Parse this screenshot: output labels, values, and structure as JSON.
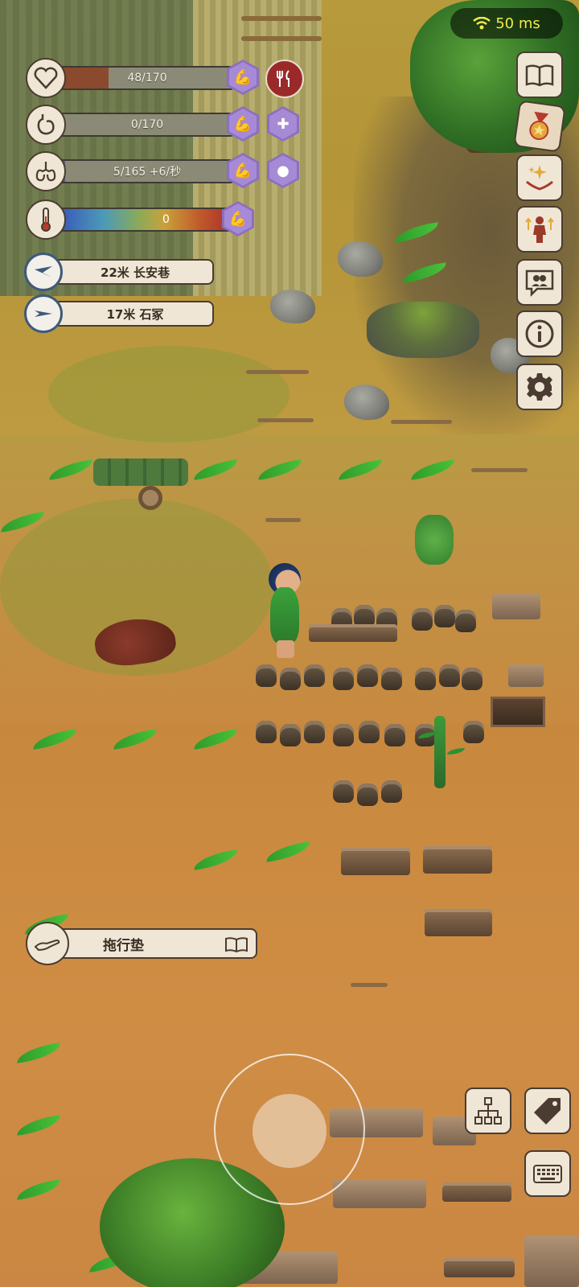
{
  "hud": {
    "ping": {
      "value": "50 ms",
      "icon": "wifi-icon"
    },
    "stats": {
      "health": {
        "text": "48/170",
        "icon": "heart-icon",
        "fill": 0.28,
        "fill_color": "#8b4a2e"
      },
      "food": {
        "text": "0/170",
        "icon": "stomach-icon",
        "fill": 0.0,
        "fill_color": "#8a8a6a"
      },
      "stamina": {
        "text": "5/165 +6/秒",
        "icon": "lungs-icon",
        "fill": 0.03,
        "fill_color": "#5a5a8a"
      },
      "temperature": {
        "text": "0",
        "icon": "thermometer-icon"
      }
    },
    "compass": [
      {
        "text": "22米 长安巷",
        "icon": "compass-arrow-icon"
      },
      {
        "text": "17米 石冢",
        "icon": "compass-arrow-icon"
      }
    ],
    "side_buttons": [
      {
        "icon": "book-icon"
      },
      {
        "icon": "medal-icon"
      },
      {
        "icon": "sparkle-hands-icon"
      },
      {
        "icon": "character-upgrade-icon"
      },
      {
        "icon": "chat-bubble-icon"
      },
      {
        "icon": "info-icon"
      },
      {
        "icon": "gear-icon"
      }
    ],
    "held_item": {
      "label": "拖行垫",
      "icon": "hand-icon",
      "book_icon": "book-icon"
    },
    "bottom_buttons": [
      {
        "icon": "tech-tree-icon"
      },
      {
        "icon": "tag-icon"
      },
      {
        "icon": "keyboard-icon"
      }
    ]
  },
  "colors": {
    "panel": "#efe6d6",
    "panel_border": "#4a3c30",
    "buff_purple": "#a78ad6",
    "eat_red": "#9a2a2a",
    "ping_text": "#f2ea4a"
  }
}
